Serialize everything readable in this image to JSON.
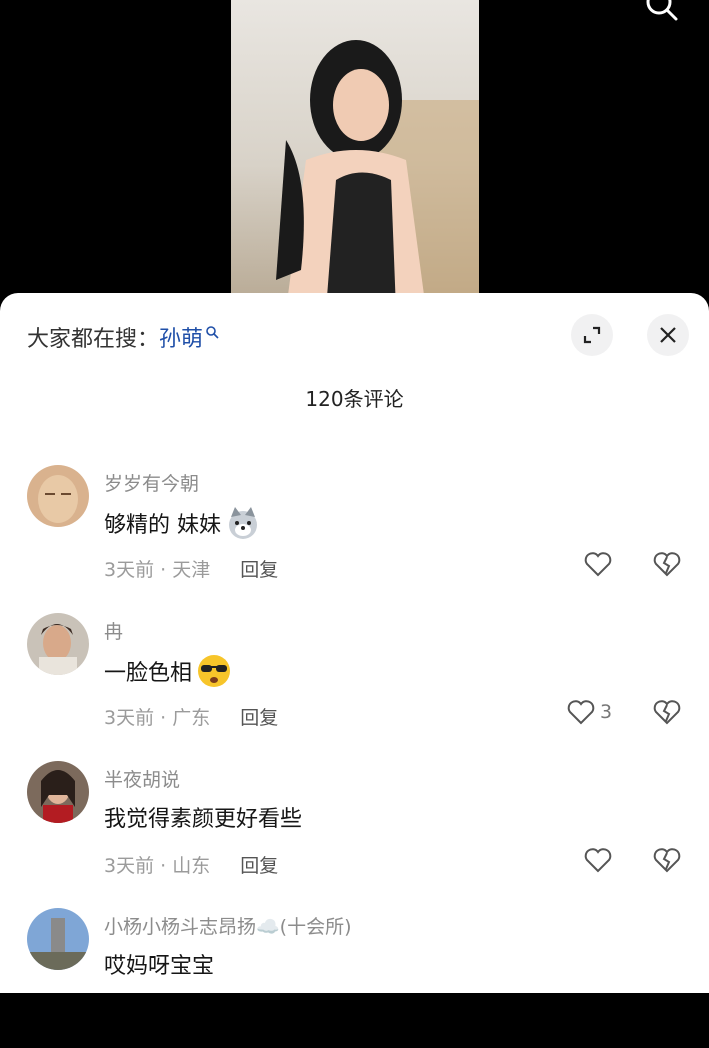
{
  "search_bar": {
    "prefix": "大家都在搜：",
    "term": "孙萌"
  },
  "comment_count": "120条评论",
  "comments": [
    {
      "username": "岁岁有今朝",
      "text": "够精的  妹妹",
      "emoji": "wolf-emoji",
      "time_location": "3天前 · 天津",
      "reply_label": "回复",
      "likes": ""
    },
    {
      "username": "冉",
      "text": "一脸色相",
      "emoji": "sunglasses-emoji",
      "time_location": "3天前 · 广东",
      "reply_label": "回复",
      "likes": "3"
    },
    {
      "username": "半夜胡说",
      "text": "我觉得素颜更好看些",
      "emoji": "",
      "time_location": "3天前 · 山东",
      "reply_label": "回复",
      "likes": ""
    },
    {
      "username": "小杨小杨斗志昂扬☁️(十会所)",
      "text": "哎妈呀宝宝",
      "emoji": "",
      "time_location": "",
      "reply_label": "",
      "likes": ""
    }
  ],
  "colors": {
    "search_term": "#1f4fa8",
    "meta_text": "#9b9b9b"
  }
}
